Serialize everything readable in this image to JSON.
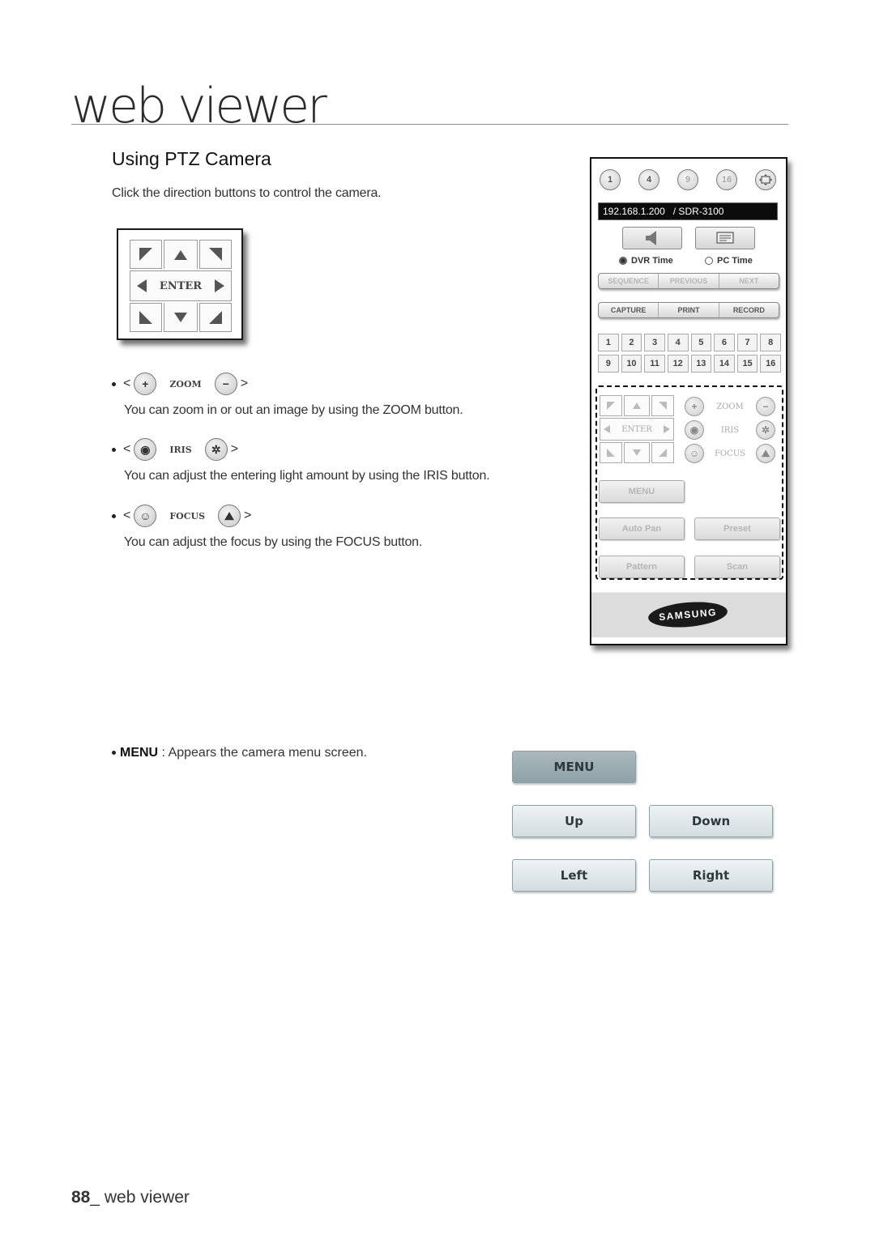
{
  "header": {
    "title": "web viewer"
  },
  "section": {
    "title": "Using PTZ Camera",
    "intro": "Click the direction buttons to control the camera."
  },
  "dpad": {
    "center_label": "ENTER"
  },
  "controls": [
    {
      "label": "ZOOM",
      "left_icon": "zoom-in-icon",
      "right_icon": "zoom-out-icon",
      "left_glyph": "+",
      "right_glyph": "−",
      "description": "You can zoom in or out an image by using the ZOOM button."
    },
    {
      "label": "IRIS",
      "left_icon": "iris-open-icon",
      "right_icon": "iris-close-icon",
      "left_glyph": "◉",
      "right_glyph": "✲",
      "description": "You can adjust the entering light amount by using the IRIS button."
    },
    {
      "label": "FOCUS",
      "left_icon": "focus-near-icon",
      "right_icon": "focus-far-icon",
      "left_glyph": "☺",
      "right_glyph": "⛰",
      "description": "You can adjust the focus by using the FOCUS button."
    }
  ],
  "bracket_open": "<",
  "bracket_close": ">",
  "ptz_panel": {
    "split_buttons": [
      "1",
      "4",
      "9",
      "16"
    ],
    "fullscreen_icon": "fullscreen-icon",
    "ip_address": "192.168.1.200",
    "model": "/ SDR-3100",
    "audio_icon": "speaker-icon",
    "osd_icon": "monitor-icon",
    "time_options": [
      {
        "label": "DVR Time",
        "selected": true
      },
      {
        "label": "PC Time",
        "selected": false
      }
    ],
    "nav_buttons": [
      "SEQUENCE",
      "PREVIOUS",
      "NEXT"
    ],
    "action_buttons": [
      "CAPTURE",
      "PRINT",
      "RECORD"
    ],
    "channels": [
      "1",
      "2",
      "3",
      "4",
      "5",
      "6",
      "7",
      "8",
      "9",
      "10",
      "11",
      "12",
      "13",
      "14",
      "15",
      "16"
    ],
    "ptz_labels": {
      "enter": "ENTER",
      "zoom": "ZOOM",
      "iris": "IRIS",
      "focus": "FOCUS"
    },
    "menu_label": "MENU",
    "ptz_buttons": [
      "Auto Pan",
      "Preset",
      "Pattern",
      "Scan"
    ],
    "brand": "SAMSUNG"
  },
  "menu_section": {
    "term": "MENU",
    "description": " : Appears the camera menu screen.",
    "buttons": {
      "menu": "MENU",
      "up": "Up",
      "down": "Down",
      "left": "Left",
      "right": "Right"
    }
  },
  "footer": {
    "page_number": "88",
    "separator": "_ ",
    "section": "web viewer"
  }
}
